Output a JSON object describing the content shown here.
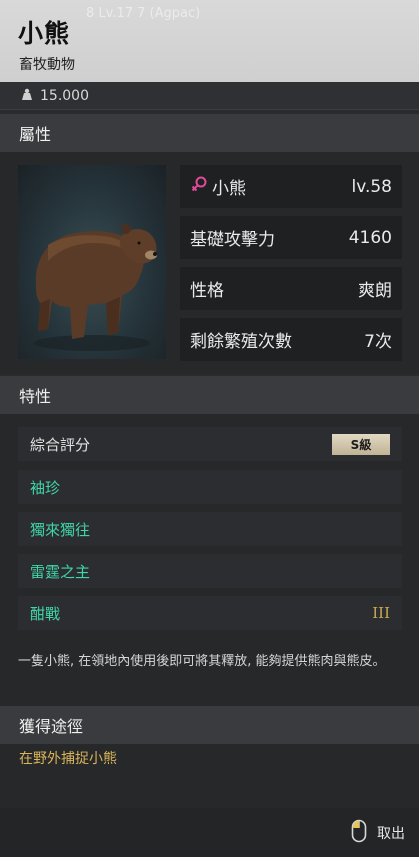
{
  "header": {
    "title": "小熊",
    "subtitle": "畜牧動物",
    "ghost_text": "8 Lv.17 7 (Agpac)"
  },
  "weight": {
    "icon": "weight-icon",
    "value": "15.000"
  },
  "attributes": {
    "heading": "屬性",
    "stats": [
      {
        "label": "小熊",
        "value": "lv.58",
        "icon": "female-icon"
      },
      {
        "label": "基礎攻擊力",
        "value": "4160"
      },
      {
        "label": "性格",
        "value": "爽朗"
      },
      {
        "label": "剩餘繁殖次數",
        "value": "7次"
      }
    ]
  },
  "traits": {
    "heading": "特性",
    "rating_label": "綜合評分",
    "rating_value": "S級",
    "items": [
      {
        "name": "袖珍",
        "level": ""
      },
      {
        "name": "獨來獨往",
        "level": ""
      },
      {
        "name": "雷霆之主",
        "level": ""
      },
      {
        "name": "酣戰",
        "level": "III"
      }
    ]
  },
  "description": "一隻小熊, 在領地內使用後即可將其釋放, 能夠提供熊肉與熊皮。",
  "acquire": {
    "heading": "獲得途徑",
    "method": "在野外捕捉小熊"
  },
  "footer": {
    "cancel_label": "取出",
    "icon": "mouse-icon"
  },
  "colors": {
    "header_bg": "#d4d4d4",
    "panel_bg": "#272829",
    "section_bg": "#3a3b3e",
    "trait_green": "#3fd6a8",
    "acquire_gold": "#d8b45a",
    "female_pink": "#e04a9a"
  }
}
